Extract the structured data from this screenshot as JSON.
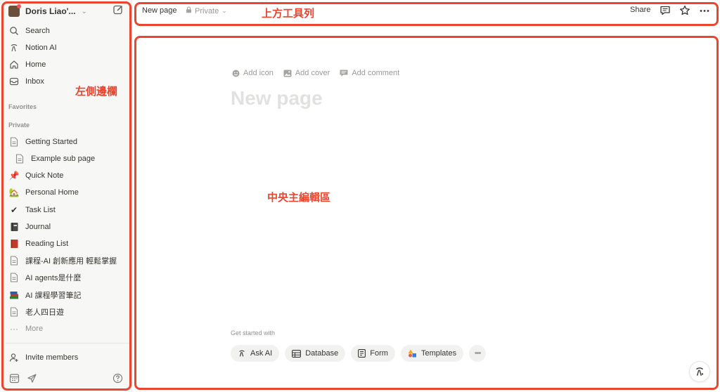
{
  "sidebar": {
    "workspace_name": "Doris Liao'...",
    "nav": [
      {
        "label": "Search",
        "icon": "search-icon"
      },
      {
        "label": "Notion AI",
        "icon": "notion-ai-icon"
      },
      {
        "label": "Home",
        "icon": "home-icon"
      },
      {
        "label": "Inbox",
        "icon": "inbox-icon"
      }
    ],
    "favorites_label": "Favorites",
    "private_label": "Private",
    "pages": [
      {
        "label": "Getting Started",
        "icon": "page-icon"
      },
      {
        "label": "Example sub page",
        "icon": "page-icon"
      },
      {
        "label": "Quick Note",
        "icon": "pushpin-icon",
        "emoji": "📌"
      },
      {
        "label": "Personal Home",
        "icon": "house-emoji-icon",
        "emoji": "🏡"
      },
      {
        "label": "Task List",
        "icon": "checkmark-icon",
        "emoji": "✔"
      },
      {
        "label": "Journal",
        "icon": "notebook-icon",
        "emoji": "📓"
      },
      {
        "label": "Reading List",
        "icon": "book-icon",
        "emoji": "📕"
      },
      {
        "label": "課程-AI 創新應用 輕鬆掌握",
        "icon": "page-icon"
      },
      {
        "label": "AI agents是什麼",
        "icon": "page-icon"
      },
      {
        "label": "AI 課程學習筆記",
        "icon": "books-icon",
        "emoji": "📚"
      },
      {
        "label": "老人四日遊",
        "icon": "page-icon"
      }
    ],
    "more_label": "More",
    "invite_label": "Invite members"
  },
  "topbar": {
    "page_title": "New page",
    "privacy": "Private",
    "share_label": "Share"
  },
  "editor": {
    "add_icon": "Add icon",
    "add_cover": "Add cover",
    "add_comment": "Add comment",
    "title_placeholder": "New page",
    "get_started_label": "Get started with",
    "pills": [
      "Ask AI",
      "Database",
      "Form",
      "Templates"
    ]
  },
  "annotations": {
    "sidebar": "左側邊欄",
    "topbar": "上方工具列",
    "editor": "中央主編輯區"
  },
  "colors": {
    "annotation": "#e8462f",
    "sidebar_bg": "#f7f7f5"
  }
}
